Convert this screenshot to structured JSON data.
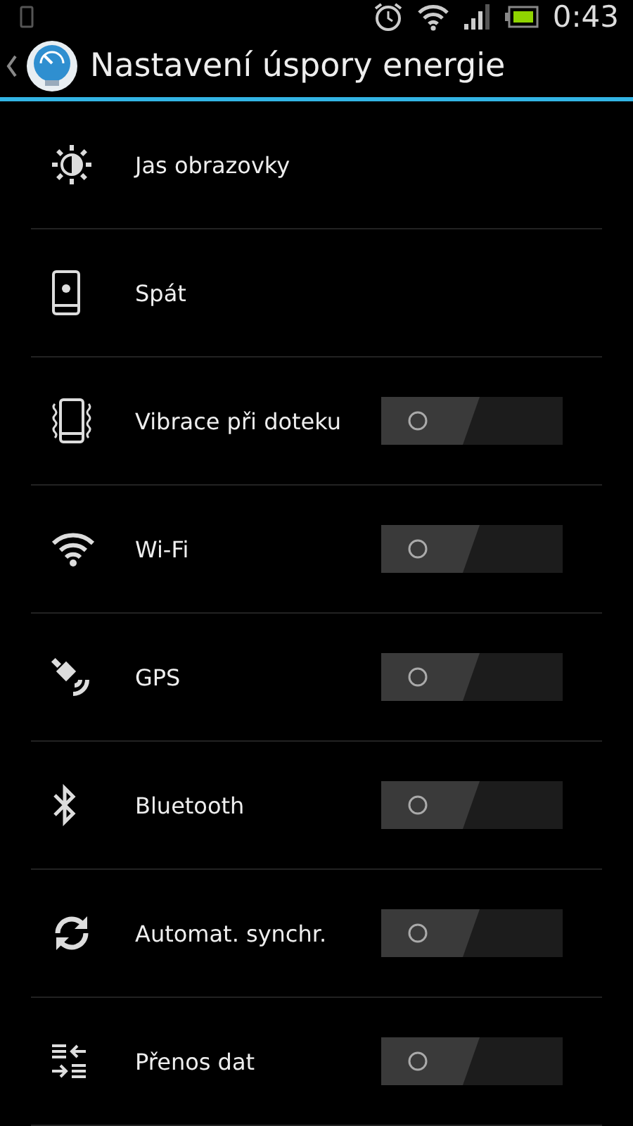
{
  "status_bar": {
    "time": "0:43"
  },
  "action_bar": {
    "title": "Nastavení úspory energie"
  },
  "items": [
    {
      "label": "Jas obrazovky",
      "kind": "plain"
    },
    {
      "label": "Spát",
      "kind": "plain"
    },
    {
      "label": "Vibrace při doteku",
      "kind": "toggle",
      "on": false
    },
    {
      "label": "Wi-Fi",
      "kind": "toggle",
      "on": false
    },
    {
      "label": "GPS",
      "kind": "toggle",
      "on": false
    },
    {
      "label": "Bluetooth",
      "kind": "toggle",
      "on": false
    },
    {
      "label": "Automat. synchr.",
      "kind": "toggle",
      "on": false
    },
    {
      "label": "Přenos dat",
      "kind": "toggle",
      "on": false
    }
  ]
}
